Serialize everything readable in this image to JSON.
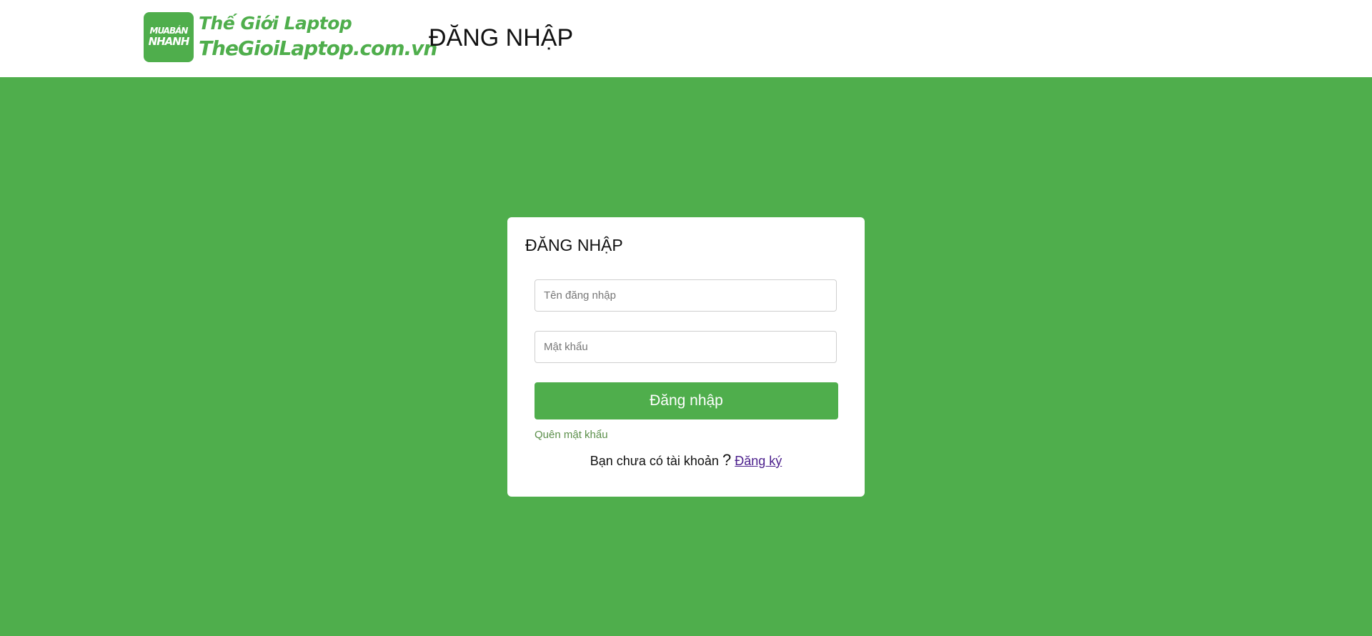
{
  "header": {
    "logo": {
      "badge_line1": "MUABÁN",
      "badge_line2": "NHANH",
      "line1": "Thế Giới Laptop",
      "line2": "TheGioiLaptop.com.vn"
    },
    "title": "ĐĂNG NHẬP"
  },
  "login_form": {
    "title": "ĐĂNG NHẬP",
    "username_placeholder": "Tên đăng nhập",
    "username_value": "",
    "password_placeholder": "Mật khẩu",
    "password_value": "",
    "submit_label": "Đăng nhập",
    "forgot_password_label": "Quên mật khẩu",
    "no_account_text": "Bạn chưa có tài khoản",
    "question_mark": "?",
    "register_label": "Đăng ký"
  },
  "colors": {
    "brand_green": "#4fae4c",
    "link_purple": "#4b1f8c",
    "forgot_link_green": "#5b8f4a",
    "card_background": "#ffffff"
  }
}
